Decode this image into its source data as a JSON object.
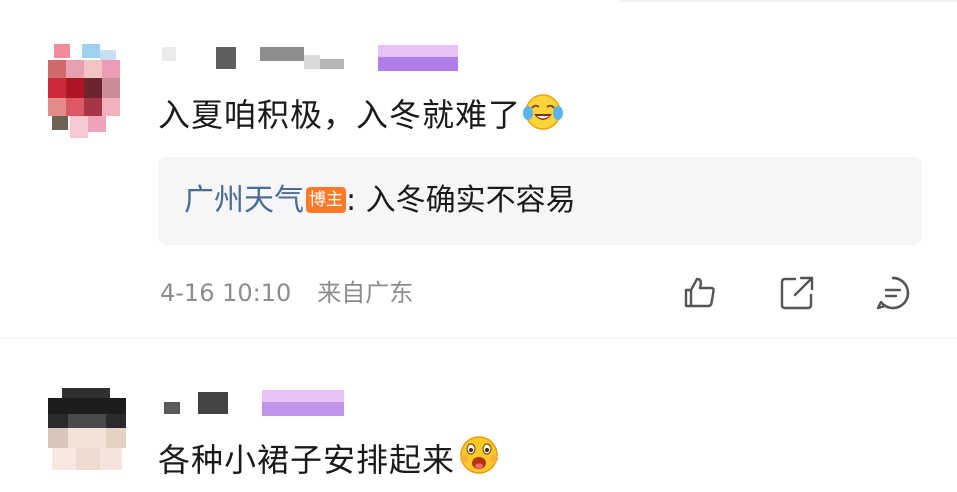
{
  "comments": [
    {
      "text": "入夏咱积极，入冬就难了",
      "emoji": "laugh-cry-emoji",
      "reply": {
        "author": "广州天气",
        "badge": "博主",
        "separator": ": ",
        "text": "入冬确实不容易"
      },
      "time": "4-16 10:10",
      "location": "来自广东",
      "actions": [
        "like-icon",
        "share-icon",
        "comment-icon"
      ]
    },
    {
      "text": "各种小裙子安排起来",
      "emoji": "excited-grin-emoji"
    }
  ],
  "colors": {
    "text": "#1a1a1a",
    "reply_author": "#4a6d97",
    "badge": "#ff7a26",
    "meta": "#8c8c8c",
    "reply_bg": "#f6f6f8"
  }
}
